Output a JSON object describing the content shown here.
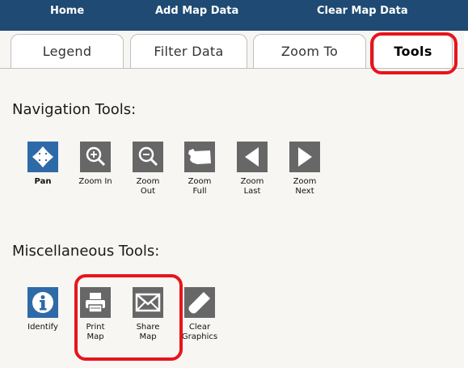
{
  "topnav": {
    "home": "Home",
    "add_map_data": "Add Map Data",
    "clear_map_data": "Clear Map Data"
  },
  "tabs": [
    {
      "label": "Legend"
    },
    {
      "label": "Filter Data"
    },
    {
      "label": "Zoom To"
    },
    {
      "label": "Tools",
      "active": true
    }
  ],
  "navigation": {
    "heading": "Navigation Tools:",
    "tools": [
      {
        "label1": "Pan",
        "label2": "",
        "icon": "pan-arrows-icon"
      },
      {
        "label1": "Zoom In",
        "label2": "",
        "icon": "zoom-in-icon"
      },
      {
        "label1": "Zoom",
        "label2": "Out",
        "icon": "zoom-out-icon"
      },
      {
        "label1": "Zoom",
        "label2": "Full",
        "icon": "zoom-full-state-icon"
      },
      {
        "label1": "Zoom",
        "label2": "Last",
        "icon": "arrow-left-icon"
      },
      {
        "label1": "Zoom",
        "label2": "Next",
        "icon": "arrow-right-icon"
      }
    ]
  },
  "misc": {
    "heading": "Miscellaneous Tools:",
    "tools": [
      {
        "label1": "Identify",
        "label2": "",
        "icon": "info-icon"
      },
      {
        "label1": "Print",
        "label2": "Map",
        "icon": "printer-icon"
      },
      {
        "label1": "Share",
        "label2": "Map",
        "icon": "envelope-icon"
      },
      {
        "label1": "Clear",
        "label2": "Graphics",
        "icon": "eraser-icon"
      }
    ]
  },
  "colors": {
    "nav_bar": "#1e4a73",
    "tool_gray": "#676767",
    "tool_blue": "#2f6aa8",
    "highlight_red": "#e8141b"
  }
}
